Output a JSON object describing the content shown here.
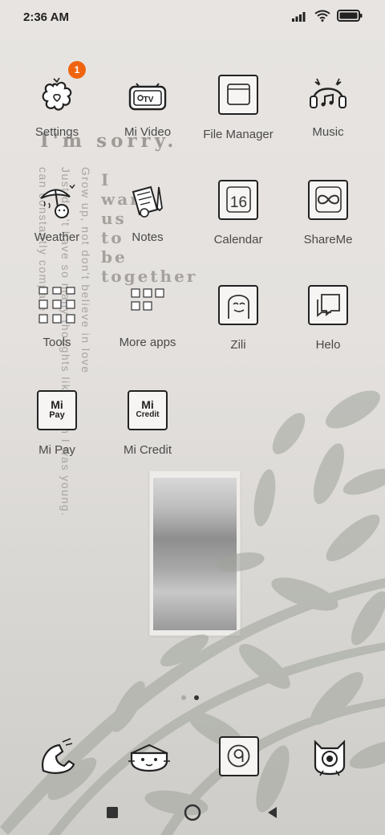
{
  "status_bar": {
    "time": "2:36 AM",
    "icons": [
      "signal-icon",
      "wifi-icon",
      "battery-icon"
    ]
  },
  "wallpaper": {
    "headline": "I'm sorry.",
    "phrase_lines": [
      "I",
      "want",
      "us",
      "to",
      "be",
      "together"
    ],
    "vertical_lines": [
      "Grow up, not don't believe in love",
      "Just don't have so many thoughts like when I was young.",
      "can constantly compare"
    ]
  },
  "apps": [
    {
      "label": "Settings",
      "icon": "settings-icon",
      "badge": "1"
    },
    {
      "label": "Mi Video",
      "icon": "tv-icon"
    },
    {
      "label": "File Manager",
      "icon": "folder-icon"
    },
    {
      "label": "Music",
      "icon": "headphones-icon"
    },
    {
      "label": "Weather",
      "icon": "weather-icon"
    },
    {
      "label": "Notes",
      "icon": "notes-icon"
    },
    {
      "label": "Calendar",
      "icon": "calendar-icon",
      "day": "16"
    },
    {
      "label": "ShareMe",
      "icon": "shareme-icon"
    },
    {
      "label": "Tools",
      "icon": "folder-grid-icon"
    },
    {
      "label": "More apps",
      "icon": "folder-grid-icon"
    },
    {
      "label": "Zili",
      "icon": "zili-icon"
    },
    {
      "label": "Helo",
      "icon": "chat-icon"
    },
    {
      "label": "Mi Pay",
      "icon": "mi-pay-icon",
      "tile_text": [
        "Mi",
        "Pay"
      ]
    },
    {
      "label": "Mi Credit",
      "icon": "mi-credit-icon",
      "tile_text": [
        "Mi",
        "Credit"
      ]
    }
  ],
  "page_indicator": {
    "pages": 2,
    "current": 2
  },
  "dock": [
    "phone-icon",
    "messages-icon",
    "camera-icon",
    "browser-icon"
  ],
  "nav_bar": [
    "recents-button",
    "home-button",
    "back-button"
  ]
}
